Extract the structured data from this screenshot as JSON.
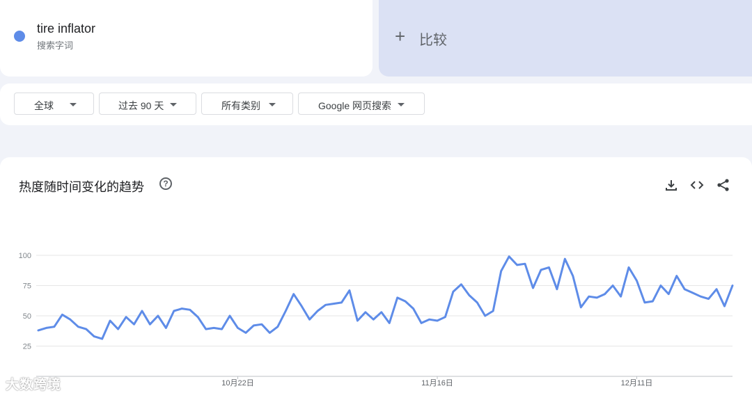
{
  "colors": {
    "series": "#5e8ce8",
    "compare_bg": "#dbe1f4",
    "page_bg": "#f1f3f9"
  },
  "term": {
    "name": "tire inflator",
    "type": "搜索字词",
    "dot_color": "#5e8ce8",
    "icon": "series-dot-icon"
  },
  "compare": {
    "label": "比较",
    "icon": "plus-icon"
  },
  "filters": [
    {
      "label": "全球",
      "icon": "caret-down-icon"
    },
    {
      "label": "过去 90 天",
      "icon": "caret-down-icon"
    },
    {
      "label": "所有类别",
      "icon": "caret-down-icon"
    },
    {
      "label": "Google 网页搜索",
      "icon": "caret-down-icon"
    }
  ],
  "chart_panel": {
    "title": "热度随时间变化的趋势",
    "actions": [
      "help-icon",
      "download-icon",
      "embed-code-icon",
      "share-icon"
    ]
  },
  "watermark": "大数跨境",
  "chart_data": {
    "type": "line",
    "title": "热度随时间变化的趋势",
    "xlabel": "",
    "ylabel": "",
    "ylim": [
      0,
      100
    ],
    "yticks": [
      "100",
      "75",
      "50",
      "25"
    ],
    "xtick_labels": [
      "10月22日",
      "11月16日",
      "12月11日"
    ],
    "grid": true,
    "series": [
      {
        "values": [
          38,
          40,
          41,
          51,
          47,
          41,
          39,
          33,
          31,
          46,
          39,
          49,
          43,
          54,
          43,
          50,
          40,
          54,
          56,
          55,
          49,
          39,
          40,
          39,
          50,
          40,
          36,
          42,
          43,
          36,
          41,
          54,
          68,
          58,
          47,
          54,
          59,
          60,
          61,
          71,
          46,
          53,
          47,
          53,
          44,
          65,
          62,
          56,
          44,
          47,
          46,
          49,
          70,
          76,
          67,
          61,
          50,
          54,
          87,
          99,
          92,
          93,
          73,
          88,
          90,
          72,
          97,
          83,
          57,
          66,
          65,
          68,
          75,
          66,
          90,
          79,
          61,
          62,
          75,
          68,
          83,
          72,
          69,
          66,
          64,
          72,
          58,
          75
        ]
      }
    ]
  }
}
